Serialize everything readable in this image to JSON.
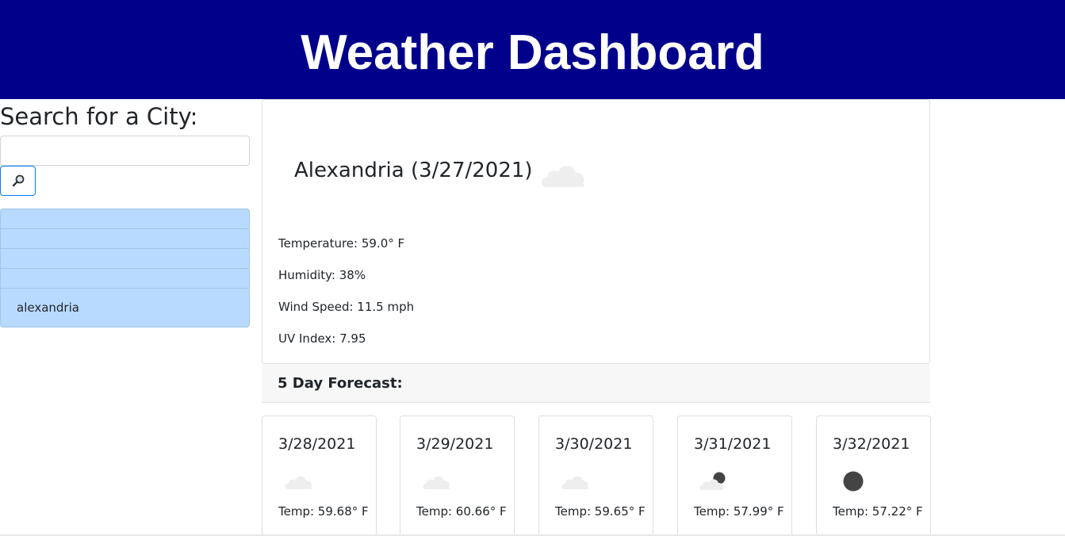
{
  "header": {
    "title": "Weather Dashboard",
    "background": "#00008b"
  },
  "search": {
    "label": "Search for a City:",
    "input_value": "",
    "placeholder": "",
    "button_icon": "magnifier-icon"
  },
  "history": {
    "items": [
      "",
      "",
      "",
      "",
      "alexandria"
    ],
    "background": "#b8daff"
  },
  "current": {
    "title": "Alexandria (3/27/2021)",
    "icon": "cloud-icon",
    "temperature": "Temperature: 59.0° F",
    "humidity": "Humidity: 38%",
    "wind": "Wind Speed: 11.5 mph",
    "uv": "UV Index: 7.95"
  },
  "forecast": {
    "heading": "5 Day Forecast:",
    "days": [
      {
        "date": "3/28/2021",
        "icon": "cloud-icon",
        "temp": "Temp: 59.68° F"
      },
      {
        "date": "3/29/2021",
        "icon": "cloud-icon",
        "temp": "Temp: 60.66° F"
      },
      {
        "date": "3/30/2021",
        "icon": "cloud-icon",
        "temp": "Temp: 59.65° F"
      },
      {
        "date": "3/31/2021",
        "icon": "cloud-moon-icon",
        "temp": "Temp: 57.99° F"
      },
      {
        "date": "3/32/2021",
        "icon": "moon-icon",
        "temp": "Temp: 57.22° F"
      }
    ]
  }
}
